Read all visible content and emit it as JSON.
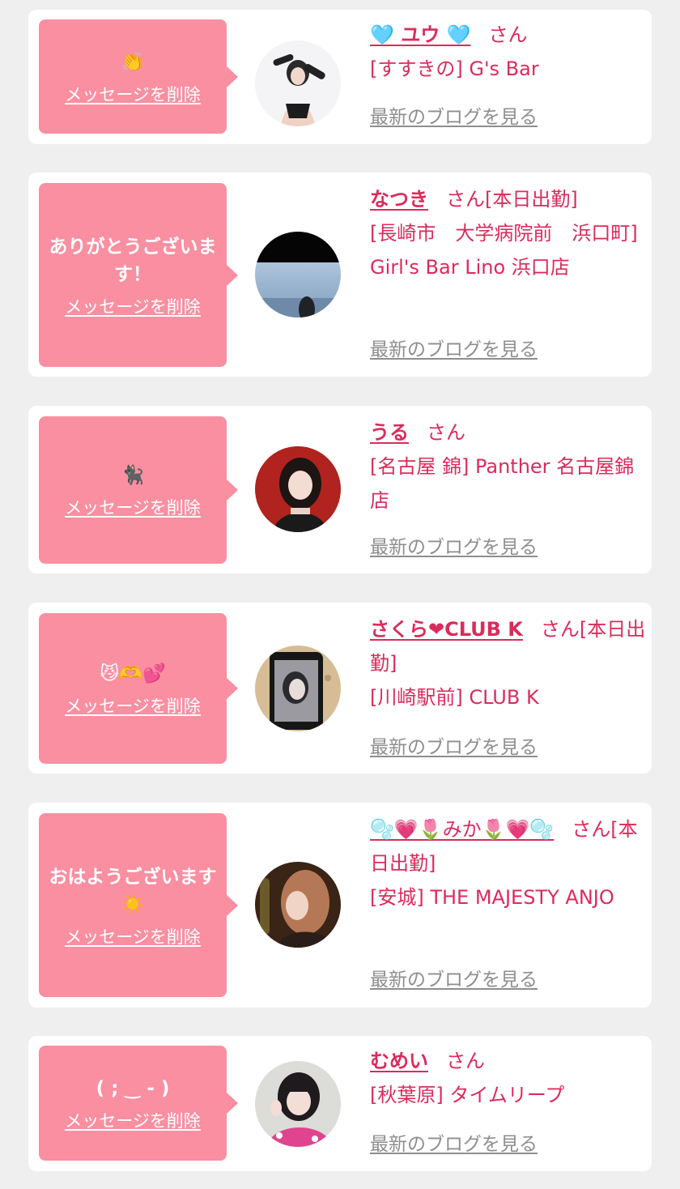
{
  "delete_label": "メッセージを削除",
  "blog_label": "最新のブログを見る",
  "honorific": "さん",
  "colors": {
    "page_bg": "#efefef",
    "card_bg": "#ffffff",
    "bubble_bg": "#f98fa1",
    "accent_text": "#dc2b5b",
    "muted_link": "#8e8e8e"
  },
  "messages": [
    {
      "message": "👏",
      "name": "🩵 ユウ 🩵",
      "status": "",
      "location": "[すすきの] G's Bar",
      "avatar": "avatar-photo-1"
    },
    {
      "message": "ありがとうございます！",
      "name": "なつき",
      "status": "[本日出勤]",
      "location": "[長崎市　大学病院前　浜口町] Girl's Bar Lino 浜口店",
      "avatar": "avatar-photo-2"
    },
    {
      "message": "🐈‍⬛",
      "name": "うる",
      "status": "",
      "location": "[名古屋 錦] Panther 名古屋錦店",
      "avatar": "avatar-photo-3"
    },
    {
      "message": "😼🫶💕",
      "name": "さくら❤CLUB K",
      "status": "[本日出勤]",
      "location": "[川崎駅前] CLUB K",
      "avatar": "avatar-photo-4"
    },
    {
      "message": "おはようございます☀️",
      "name": "🫧💗🌷みか🌷💗🫧",
      "status": "[本日出勤]",
      "location": "[安城] THE MAJESTY ANJO",
      "avatar": "avatar-photo-5"
    },
    {
      "message": "( ; ‿ - )",
      "name": "むめい",
      "status": "",
      "location": "[秋葉原] タイムリープ",
      "avatar": "avatar-photo-6"
    }
  ]
}
